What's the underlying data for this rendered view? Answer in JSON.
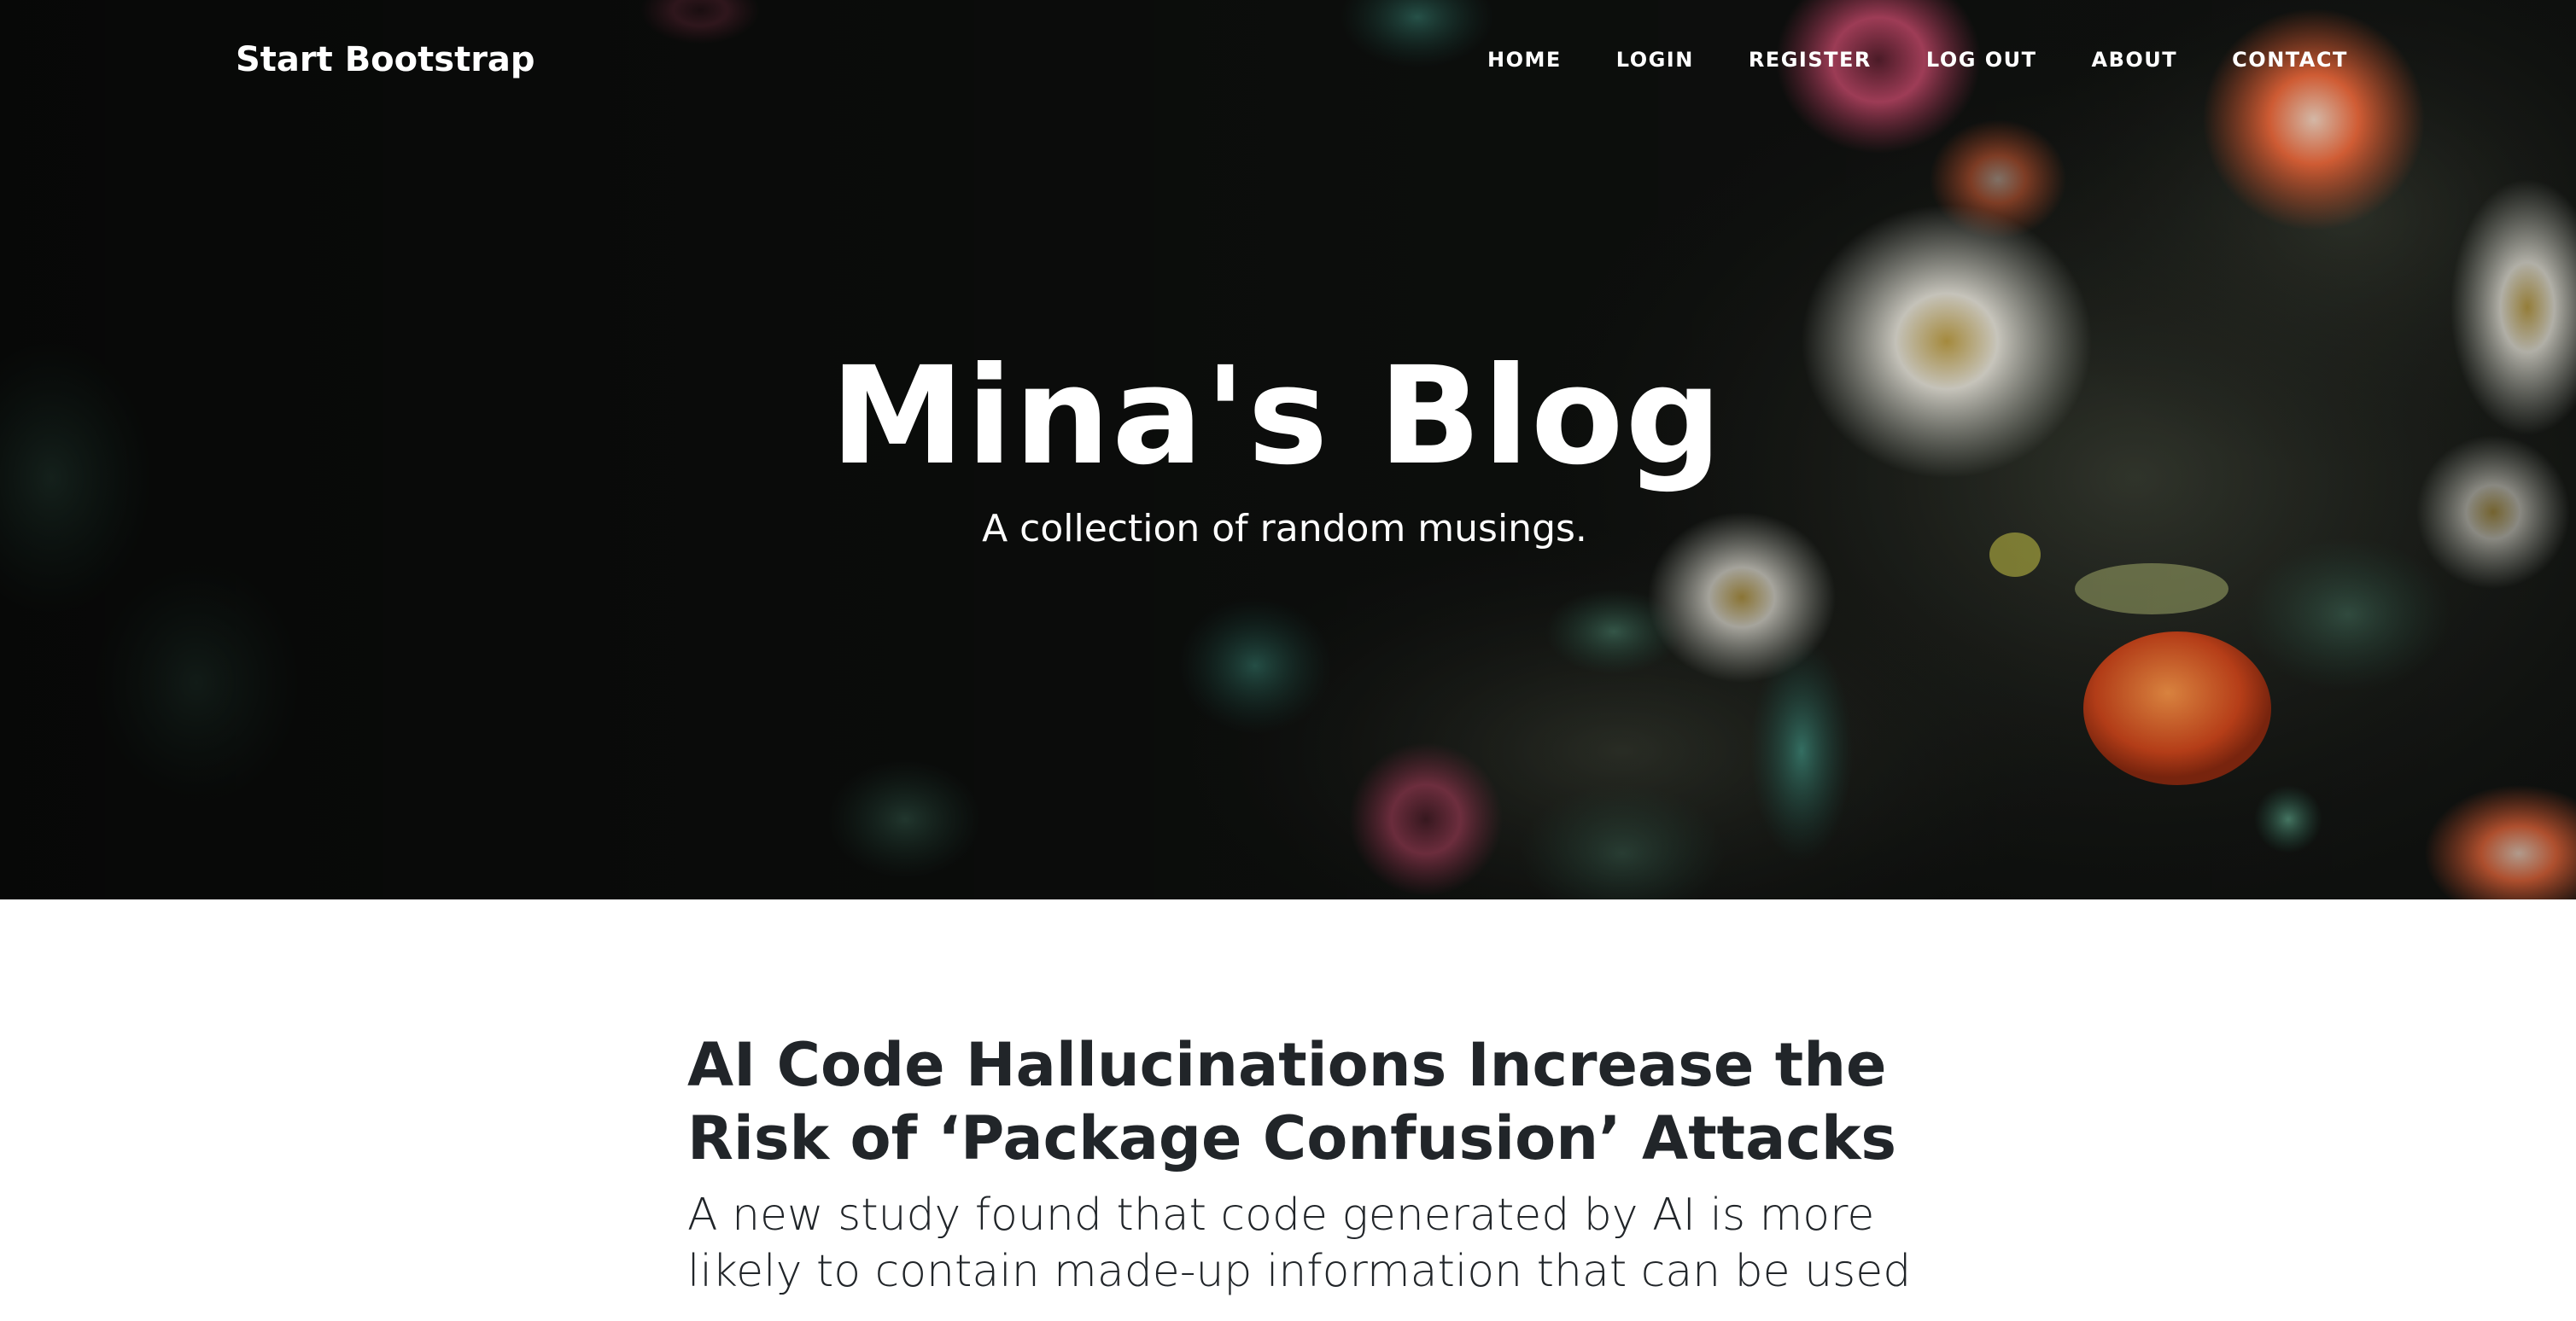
{
  "navbar": {
    "brand": "Start Bootstrap",
    "links": [
      {
        "label": "HOME"
      },
      {
        "label": "LOGIN"
      },
      {
        "label": "REGISTER"
      },
      {
        "label": "LOG OUT"
      },
      {
        "label": "ABOUT"
      },
      {
        "label": "CONTACT"
      }
    ]
  },
  "header": {
    "title": "Mina's Blog",
    "subtitle": "A collection of random musings."
  },
  "post": {
    "title": "AI Code Hallucinations Increase the Risk of ‘Package Confusion’ Attacks",
    "subtitle": "A new study found that code generated by AI is more likely to contain made-up information that can be used"
  },
  "colors": {
    "header_overlay": "#0e0f0d",
    "text_dark": "#212529",
    "text_light": "#ffffff"
  }
}
